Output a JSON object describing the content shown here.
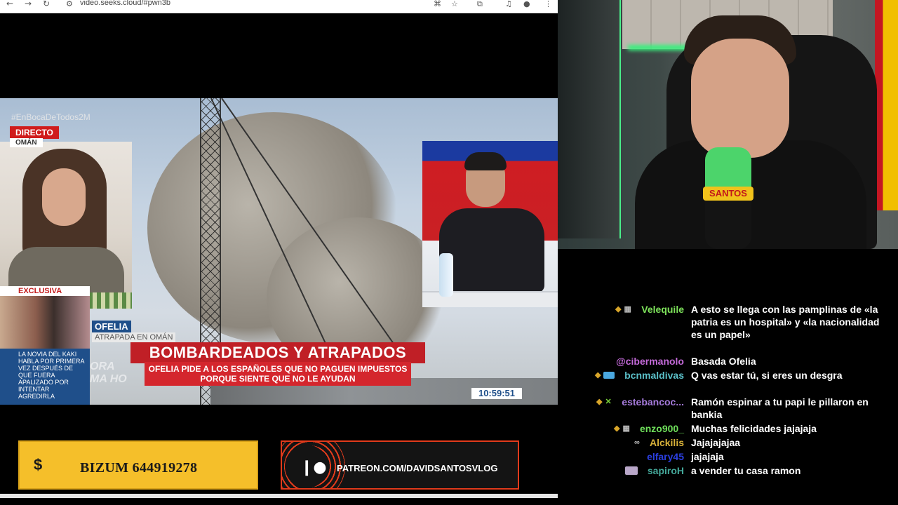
{
  "browser": {
    "url": "video.seeks.cloud/#pwn3b",
    "back_icon": "←",
    "forward_icon": "→",
    "reload_icon": "↻"
  },
  "video": {
    "hashtag": "#EnBocaDeTodos2M",
    "live_label": "DIRECTO",
    "location_label": "OMÁN",
    "exclusive_label": "EXCLUSIVA",
    "exclusive_text": "LA NOVIA DEL KAKI HABLA POR PRIMERA VEZ DESPUÉS DE QUE FUERA APALIZADO POR INTENTAR AGREDIRLA",
    "guest_name": "OFELIA",
    "guest_subtitle": "ATRAPADA EN OMÁN",
    "headline": "BOMBARDEADOS Y ATRAPADOS",
    "subheadline": "OFELIA PIDE A LOS ESPAÑOLES QUE NO PAGUEN IMPUESTOS PORQUE SIENTE QUE NO LE AYUDAN",
    "ghost_text": "ORA\nMA HO",
    "clock": "10:59:51"
  },
  "donations": {
    "bizum_icon": "$",
    "bizum_text": "BIZUM 644919278",
    "patreon_text": "PATREON.COM/DAVIDSANTOSVLOG"
  },
  "webcam": {
    "mic_brand": "SANTOS"
  },
  "chat": {
    "messages": [
      {
        "user": "Velequile",
        "color": "#7ee35b",
        "text": "A esto se llega con las pamplinas de «la patria es un hospital» y «la nacionalidad es un papel»",
        "badges": [
          "chevron",
          "film"
        ]
      },
      {
        "user": "@cibermanolo",
        "color": "#c46ad9",
        "text": "Basada Ofelia",
        "badges": []
      },
      {
        "user": "bcnmaldivas",
        "color": "#5bc0c9",
        "text": "Q vas estar tú, si eres un desgra",
        "badges": [
          "chevron",
          "sub"
        ]
      },
      {
        "user": "estebancoc...",
        "color": "#a67bdc",
        "text": "Ramón espinar a tu papi le pillaron en bankia",
        "badges": [
          "chevron",
          "x"
        ]
      },
      {
        "user": "enzo900_",
        "color": "#6fe05b",
        "text": "Muchas felicidades jajajaja",
        "badges": [
          "chevron",
          "film"
        ]
      },
      {
        "user": "Alckilis",
        "color": "#d9b23a",
        "text": "Jajajajajaa",
        "badges": [
          "glasses"
        ]
      },
      {
        "user": "elfary45",
        "color": "#2b3fe0",
        "text": "jajajaja",
        "badges": []
      },
      {
        "user": "sapiroH",
        "color": "#44a89a",
        "text": "a vender tu casa ramon",
        "badges": [
          "brand"
        ]
      }
    ]
  }
}
